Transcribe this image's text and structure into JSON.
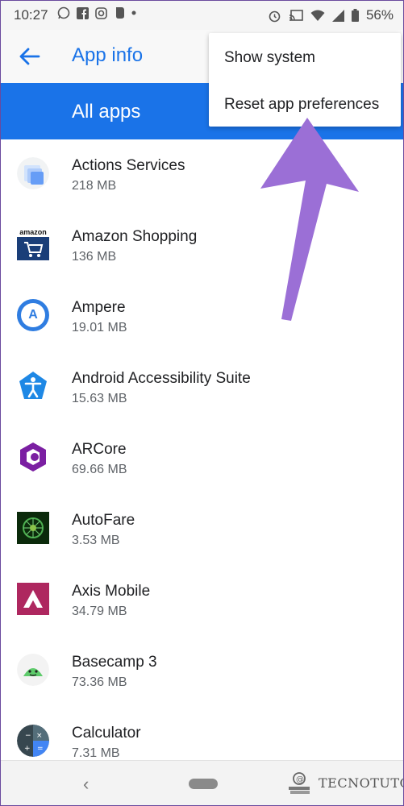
{
  "status_bar": {
    "time": "10:27",
    "battery": "56%",
    "left_icons": [
      "whatsapp-icon",
      "facebook-icon",
      "instagram-icon",
      "evernote-icon",
      "dot-icon"
    ],
    "right_icons": [
      "alarm-icon",
      "cast-icon",
      "wifi-icon",
      "signal-icon",
      "battery-icon"
    ]
  },
  "app_bar": {
    "title": "App info"
  },
  "filter": {
    "label": "All apps"
  },
  "menu": {
    "items": [
      "Show system",
      "Reset app preferences"
    ]
  },
  "apps": [
    {
      "name": "Actions Services",
      "size": "218 MB",
      "icon": "actions-services-icon"
    },
    {
      "name": "Amazon Shopping",
      "size": "136 MB",
      "icon": "amazon-shopping-icon",
      "icon_text": "amazon"
    },
    {
      "name": "Ampere",
      "size": "19.01 MB",
      "icon": "ampere-icon",
      "icon_text": "A"
    },
    {
      "name": "Android Accessibility Suite",
      "size": "15.63 MB",
      "icon": "accessibility-icon"
    },
    {
      "name": "ARCore",
      "size": "69.66 MB",
      "icon": "arcore-icon"
    },
    {
      "name": "AutoFare",
      "size": "3.53 MB",
      "icon": "autofare-icon"
    },
    {
      "name": "Axis Mobile",
      "size": "34.79 MB",
      "icon": "axis-mobile-icon"
    },
    {
      "name": "Basecamp 3",
      "size": "73.36 MB",
      "icon": "basecamp-icon"
    },
    {
      "name": "Calculator",
      "size": "7.31 MB",
      "icon": "calculator-icon"
    }
  ],
  "watermark": {
    "text": "TECNOTUTO"
  },
  "colors": {
    "accent": "#1a73e8",
    "arrow": "#9b6fd6"
  }
}
